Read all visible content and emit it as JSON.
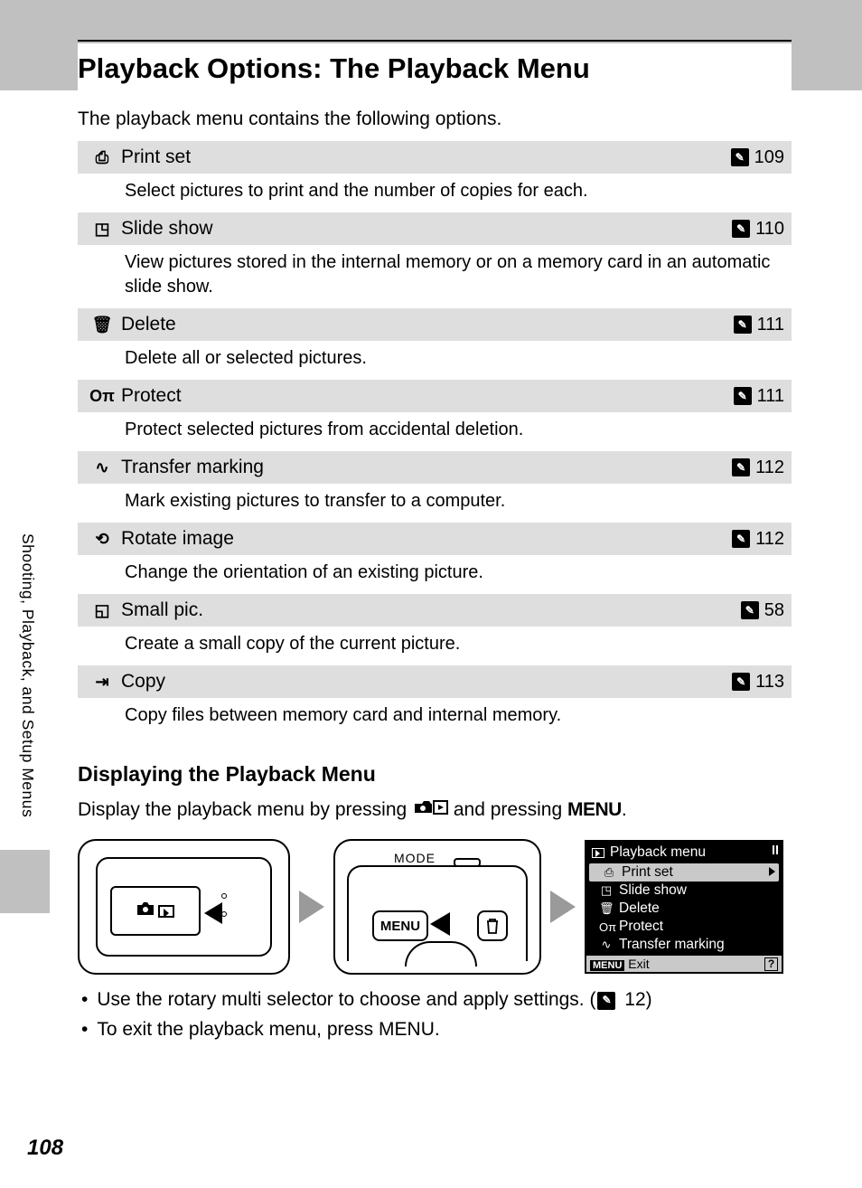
{
  "page_number": "108",
  "side_tab": "Shooting, Playback, and Setup Menus",
  "title": "Playback Options: The Playback Menu",
  "intro": "The playback menu contains the following options.",
  "options": [
    {
      "icon": "⎙",
      "name": "Print set",
      "ref": "109",
      "desc": "Select pictures to print and the number of copies for each."
    },
    {
      "icon": "◳",
      "name": "Slide show",
      "ref": "110",
      "desc": "View pictures stored in the internal memory or on a memory card in an automatic slide show."
    },
    {
      "icon": "🗑",
      "name": "Delete",
      "ref": "111",
      "desc": "Delete all or selected pictures."
    },
    {
      "icon": "Oπ",
      "name": "Protect",
      "ref": "111",
      "desc": "Protect selected pictures from accidental deletion."
    },
    {
      "icon": "∿",
      "name": "Transfer marking",
      "ref": "112",
      "desc": "Mark existing pictures to transfer to a computer."
    },
    {
      "icon": "⟲",
      "name": "Rotate image",
      "ref": "112",
      "desc": "Change the orientation of an existing picture."
    },
    {
      "icon": "◱",
      "name": "Small pic.",
      "ref": "58",
      "desc": "Create a small copy of the current picture."
    },
    {
      "icon": "⇥",
      "name": "Copy",
      "ref": "113",
      "desc": "Copy files between memory card and internal memory."
    }
  ],
  "subhead": "Displaying the Playback Menu",
  "instruction_pre": "Display the playback menu by pressing ",
  "instruction_mid": " and pressing ",
  "instruction_menu": "MENU",
  "instruction_end": ".",
  "diagram": {
    "mode_label": "MODE",
    "menu_label": "MENU"
  },
  "lcd": {
    "title": "Playback menu",
    "items": [
      {
        "icon": "⎙",
        "label": "Print set",
        "selected": true
      },
      {
        "icon": "◳",
        "label": "Slide show",
        "selected": false
      },
      {
        "icon": "🗑",
        "label": "Delete",
        "selected": false
      },
      {
        "icon": "Oπ",
        "label": "Protect",
        "selected": false
      },
      {
        "icon": "∿",
        "label": "Transfer marking",
        "selected": false
      }
    ],
    "foot_menu": "MENU",
    "foot_exit": "Exit",
    "foot_help": "?"
  },
  "bullets": [
    {
      "pre": "Use the rotary multi selector to choose and apply settings. (",
      "ref": "12",
      "post": ")"
    },
    {
      "pre": "To exit the playback menu, press ",
      "menu": "MENU",
      "post": "."
    }
  ]
}
